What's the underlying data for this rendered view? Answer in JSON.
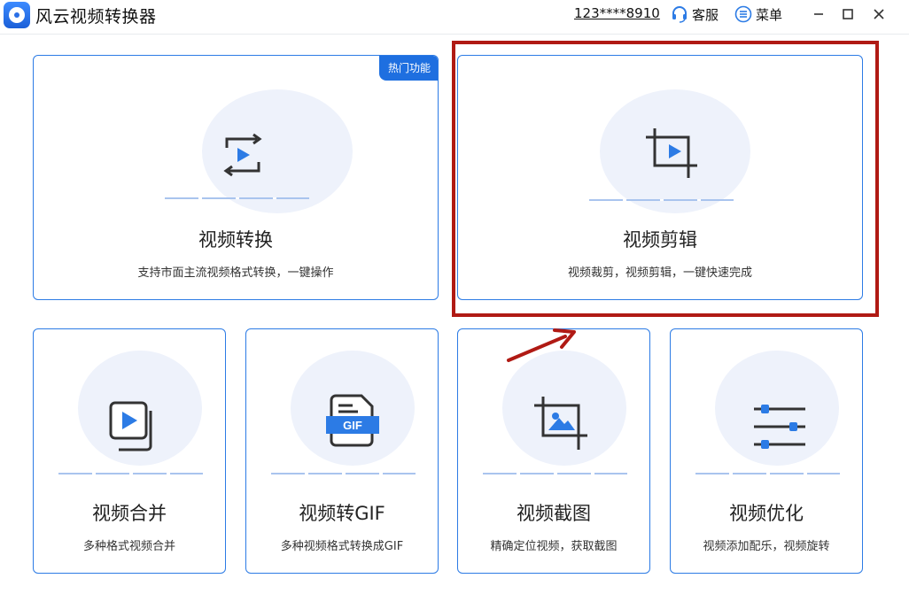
{
  "app": {
    "title": "风云视频转换器"
  },
  "header": {
    "account": "123****8910",
    "support_label": "客服",
    "menu_label": "菜单"
  },
  "cards": [
    {
      "title": "视频转换",
      "desc": "支持市面主流视频格式转换，一键操作",
      "badge": "热门功能",
      "icon": "convert-icon"
    },
    {
      "title": "视频剪辑",
      "desc": "视频裁剪，视频剪辑，一键快速完成",
      "icon": "crop-icon"
    },
    {
      "title": "视频合并",
      "desc": "多种格式视频合并",
      "icon": "merge-icon"
    },
    {
      "title": "视频转GIF",
      "desc": "多种视频格式转换成GIF",
      "icon": "gif-icon",
      "icon_text": "GIF"
    },
    {
      "title": "视频截图",
      "desc": "精确定位视频，获取截图",
      "icon": "screenshot-icon"
    },
    {
      "title": "视频优化",
      "desc": "视频添加配乐，视频旋转",
      "icon": "optimize-icon"
    }
  ],
  "colors": {
    "accent": "#2c7be5",
    "badge": "#1e6fe0",
    "annotation": "#b01a14"
  }
}
